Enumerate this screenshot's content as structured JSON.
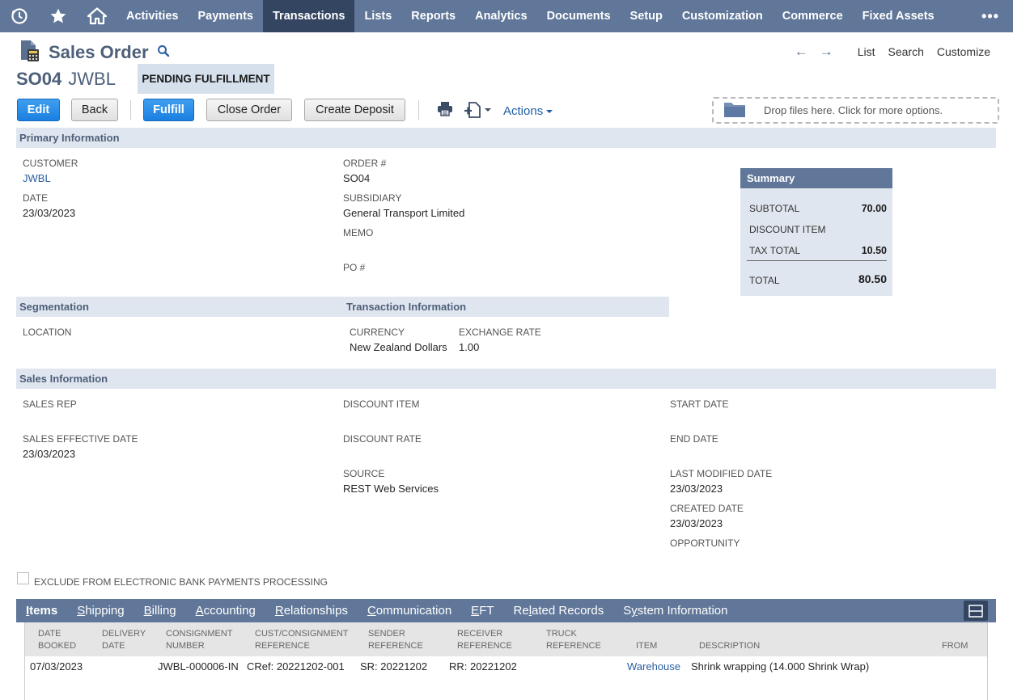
{
  "nav": {
    "items": [
      "Activities",
      "Payments",
      "Transactions",
      "Lists",
      "Reports",
      "Analytics",
      "Documents",
      "Setup",
      "Customization",
      "Commerce",
      "Fixed Assets"
    ],
    "active": "Transactions",
    "more": "•••"
  },
  "page": {
    "title": "Sales Order",
    "record_number": "SO04",
    "record_name": "JWBL",
    "status": "PENDING FULFILLMENT"
  },
  "top_links": {
    "list": "List",
    "search": "Search",
    "customize": "Customize"
  },
  "buttons": {
    "edit": "Edit",
    "back": "Back",
    "fulfill": "Fulfill",
    "close_order": "Close Order",
    "create_deposit": "Create Deposit",
    "actions": "Actions"
  },
  "dropzone": {
    "text": "Drop files here. Click for more options."
  },
  "sections": {
    "primary": "Primary Information",
    "segmentation": "Segmentation",
    "transaction": "Transaction Information",
    "sales": "Sales Information"
  },
  "primary": {
    "customer_label": "CUSTOMER",
    "customer_value": "JWBL",
    "date_label": "DATE",
    "date_value": "23/03/2023",
    "order_label": "ORDER #",
    "order_value": "SO04",
    "subsidiary_label": "SUBSIDIARY",
    "subsidiary_value": "General Transport Limited",
    "memo_label": "MEMO",
    "po_label": "PO #"
  },
  "summary": {
    "title": "Summary",
    "subtotal_label": "SUBTOTAL",
    "subtotal_value": "70.00",
    "discount_label": "DISCOUNT ITEM",
    "tax_label": "TAX TOTAL",
    "tax_value": "10.50",
    "total_label": "TOTAL",
    "total_value": "80.50"
  },
  "segmentation": {
    "location_label": "LOCATION"
  },
  "transaction": {
    "currency_label": "CURRENCY",
    "currency_value": "New Zealand Dollars",
    "exchange_label": "EXCHANGE RATE",
    "exchange_value": "1.00"
  },
  "sales": {
    "rep_label": "SALES REP",
    "effective_label": "SALES EFFECTIVE DATE",
    "effective_value": "23/03/2023",
    "discount_item_label": "DISCOUNT ITEM",
    "discount_rate_label": "DISCOUNT RATE",
    "source_label": "SOURCE",
    "source_value": "REST Web Services",
    "start_label": "START DATE",
    "end_label": "END DATE",
    "modified_label": "LAST MODIFIED DATE",
    "modified_value": "23/03/2023",
    "created_label": "CREATED DATE",
    "created_value": "23/03/2023",
    "opportunity_label": "OPPORTUNITY"
  },
  "checkbox": {
    "label": "EXCLUDE FROM ELECTRONIC BANK PAYMENTS PROCESSING"
  },
  "tabs": [
    {
      "pre": "",
      "key": "I",
      "post": "tems"
    },
    {
      "pre": "",
      "key": "S",
      "post": "hipping"
    },
    {
      "pre": "",
      "key": "B",
      "post": "illing"
    },
    {
      "pre": "",
      "key": "A",
      "post": "ccounting"
    },
    {
      "pre": "",
      "key": "R",
      "post": "elationships"
    },
    {
      "pre": "",
      "key": "C",
      "post": "ommunication"
    },
    {
      "pre": "",
      "key": "E",
      "post": "FT"
    },
    {
      "pre": "Re",
      "key": "l",
      "post": "ated Records"
    },
    {
      "pre": "S",
      "key": "y",
      "post": "stem Information"
    }
  ],
  "items_table": {
    "headers": {
      "date_booked_1": "DATE",
      "date_booked_2": "BOOKED",
      "delivery_1": "DELIVERY",
      "delivery_2": "DATE",
      "consignment_1": "CONSIGNMENT",
      "consignment_2": "NUMBER",
      "cust_1": "CUST/CONSIGNMENT",
      "cust_2": "REFERENCE",
      "sender_1": "SENDER",
      "sender_2": "REFERENCE",
      "receiver_1": "RECEIVER",
      "receiver_2": "REFERENCE",
      "truck_1": "TRUCK",
      "truck_2": "REFERENCE",
      "item": "ITEM",
      "description": "DESCRIPTION",
      "from": "FROM"
    },
    "row": {
      "date_booked": "07/03/2023",
      "consignment": "JWBL-000006-IN",
      "cust_ref": "CRef: 20221202-001",
      "sender_ref": "SR: 20221202",
      "receiver_ref": "RR: 20221202",
      "item": "Warehouse",
      "description": "Shrink wrapping (14.000 Shrink Wrap)"
    }
  }
}
